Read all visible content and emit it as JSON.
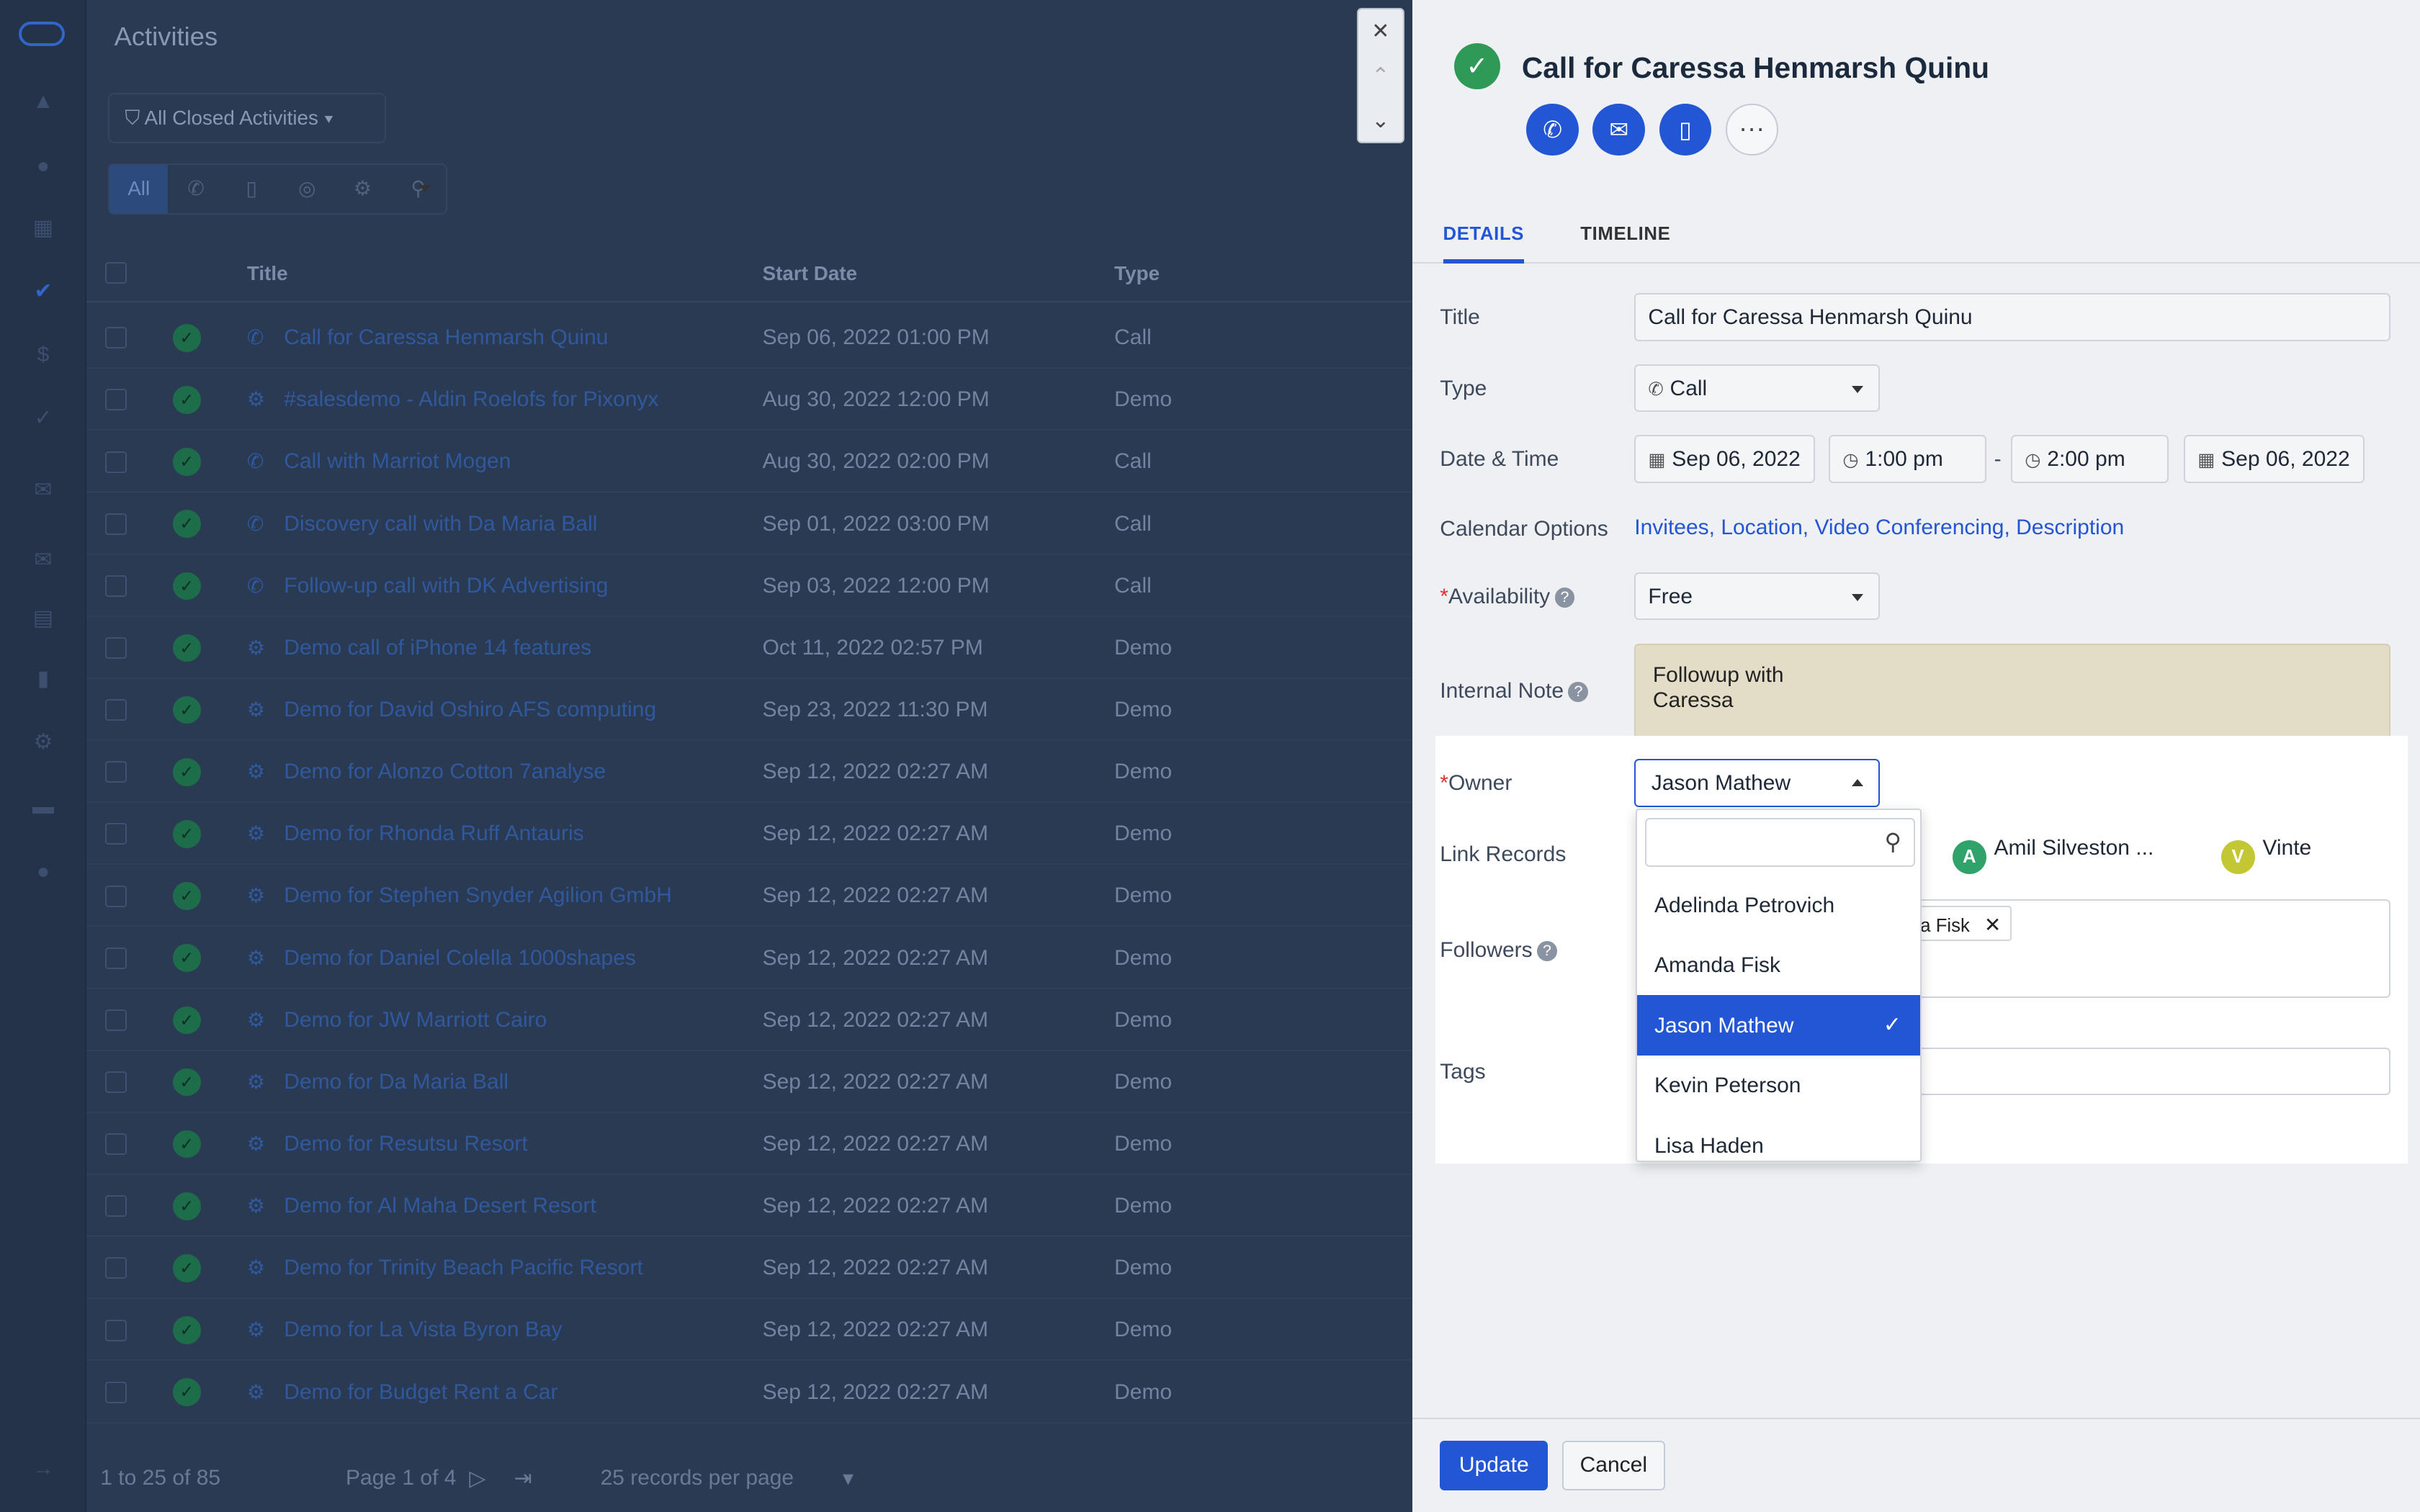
{
  "app": {
    "title": "Activities"
  },
  "filter": {
    "label": "All Closed Activities"
  },
  "type_tabs": [
    {
      "label": "All",
      "icon": "all"
    },
    {
      "label": "",
      "icon": "phone-icon"
    },
    {
      "label": "",
      "icon": "clipboard-icon"
    },
    {
      "label": "",
      "icon": "meeting-icon"
    },
    {
      "label": "",
      "icon": "demo-icon"
    },
    {
      "label": "",
      "icon": "wrench-icon"
    }
  ],
  "table": {
    "headers": {
      "title": "Title",
      "start_date": "Start Date",
      "type": "Type"
    },
    "rows": [
      {
        "title": "Call for Caressa Henmarsh Quinu",
        "start_date": "Sep 06, 2022 01:00 PM",
        "type": "Call",
        "icon": "phone-icon"
      },
      {
        "title": "#salesdemo - Aldin Roelofs for Pixonyx",
        "start_date": "Aug 30, 2022 12:00 PM",
        "type": "Demo",
        "icon": "demo-icon"
      },
      {
        "title": "Call with Marriot Mogen",
        "start_date": "Aug 30, 2022 02:00 PM",
        "type": "Call",
        "icon": "phone-icon"
      },
      {
        "title": "Discovery call with Da Maria Ball",
        "start_date": "Sep 01, 2022 03:00 PM",
        "type": "Call",
        "icon": "phone-icon"
      },
      {
        "title": "Follow-up call with DK Advertising",
        "start_date": "Sep 03, 2022 12:00 PM",
        "type": "Call",
        "icon": "phone-icon"
      },
      {
        "title": "Demo call of iPhone 14 features",
        "start_date": "Oct 11, 2022 02:57 PM",
        "type": "Demo",
        "icon": "demo-icon"
      },
      {
        "title": "Demo for David Oshiro AFS computing",
        "start_date": "Sep 23, 2022 11:30 PM",
        "type": "Demo",
        "icon": "demo-icon"
      },
      {
        "title": "Demo for Alonzo Cotton 7analyse",
        "start_date": "Sep 12, 2022 02:27 AM",
        "type": "Demo",
        "icon": "demo-icon"
      },
      {
        "title": "Demo for Rhonda Ruff Antauris",
        "start_date": "Sep 12, 2022 02:27 AM",
        "type": "Demo",
        "icon": "demo-icon"
      },
      {
        "title": "Demo for Stephen Snyder Agilion GmbH",
        "start_date": "Sep 12, 2022 02:27 AM",
        "type": "Demo",
        "icon": "demo-icon"
      },
      {
        "title": "Demo for Daniel Colella 1000shapes",
        "start_date": "Sep 12, 2022 02:27 AM",
        "type": "Demo",
        "icon": "demo-icon"
      },
      {
        "title": "Demo for JW Marriott Cairo",
        "start_date": "Sep 12, 2022 02:27 AM",
        "type": "Demo",
        "icon": "demo-icon"
      },
      {
        "title": "Demo for Da Maria Ball",
        "start_date": "Sep 12, 2022 02:27 AM",
        "type": "Demo",
        "icon": "demo-icon"
      },
      {
        "title": "Demo for Resutsu Resort",
        "start_date": "Sep 12, 2022 02:27 AM",
        "type": "Demo",
        "icon": "demo-icon"
      },
      {
        "title": "Demo for Al Maha Desert Resort",
        "start_date": "Sep 12, 2022 02:27 AM",
        "type": "Demo",
        "icon": "demo-icon"
      },
      {
        "title": "Demo for Trinity Beach Pacific Resort",
        "start_date": "Sep 12, 2022 02:27 AM",
        "type": "Demo",
        "icon": "demo-icon"
      },
      {
        "title": "Demo for La Vista Byron Bay",
        "start_date": "Sep 12, 2022 02:27 AM",
        "type": "Demo",
        "icon": "demo-icon"
      },
      {
        "title": "Demo for Budget Rent a Car",
        "start_date": "Sep 12, 2022 02:27 AM",
        "type": "Demo",
        "icon": "demo-icon"
      }
    ]
  },
  "pagination": {
    "range": "1 to 25 of 85",
    "page": "Page 1 of 4",
    "per_page": "25 records per page"
  },
  "panel": {
    "title": "Call for Caressa Henmarsh Quinu",
    "tabs": [
      "DETAILS",
      "TIMELINE"
    ],
    "fields": {
      "title_label": "Title",
      "title_value": "Call for Caressa Henmarsh Quinu",
      "type_label": "Type",
      "type_value": "Call",
      "datetime_label": "Date & Time",
      "start_date": "Sep 06, 2022",
      "start_time": "1:00 pm",
      "dash": "-",
      "end_time": "2:00 pm",
      "end_date": "Sep 06, 2022",
      "calendar_label": "Calendar Options",
      "calendar_links": [
        "Invitees,",
        "Location,",
        "Video Conferencing,",
        "Description"
      ],
      "availability_label": "Availability",
      "availability_value": "Free",
      "note_label": "Internal Note",
      "note_line1": "Followup with",
      "note_line2": "Caressa",
      "owner_label": "Owner",
      "owner_value": "Jason Mathew",
      "link_records_label": "Link Records",
      "linked": [
        {
          "initial": "A",
          "name": "Amil Silveston ...",
          "color": "#2fa36a"
        },
        {
          "initial": "V",
          "name": "Vinte",
          "color": "#c3c734"
        }
      ],
      "followers_label": "Followers",
      "follower_tag": "nda Fisk",
      "tags_label": "Tags"
    },
    "owner_dropdown": {
      "search_placeholder": "",
      "options": [
        "Adelinda Petrovich",
        "Amanda Fisk",
        "Jason Mathew",
        "Kevin Peterson",
        "Lisa Haden"
      ],
      "selected": "Jason Mathew"
    },
    "buttons": {
      "update": "Update",
      "cancel": "Cancel"
    }
  },
  "colors": {
    "accent": "#2256d4",
    "success": "#2f9a58",
    "overlay": "#2a3a53"
  }
}
